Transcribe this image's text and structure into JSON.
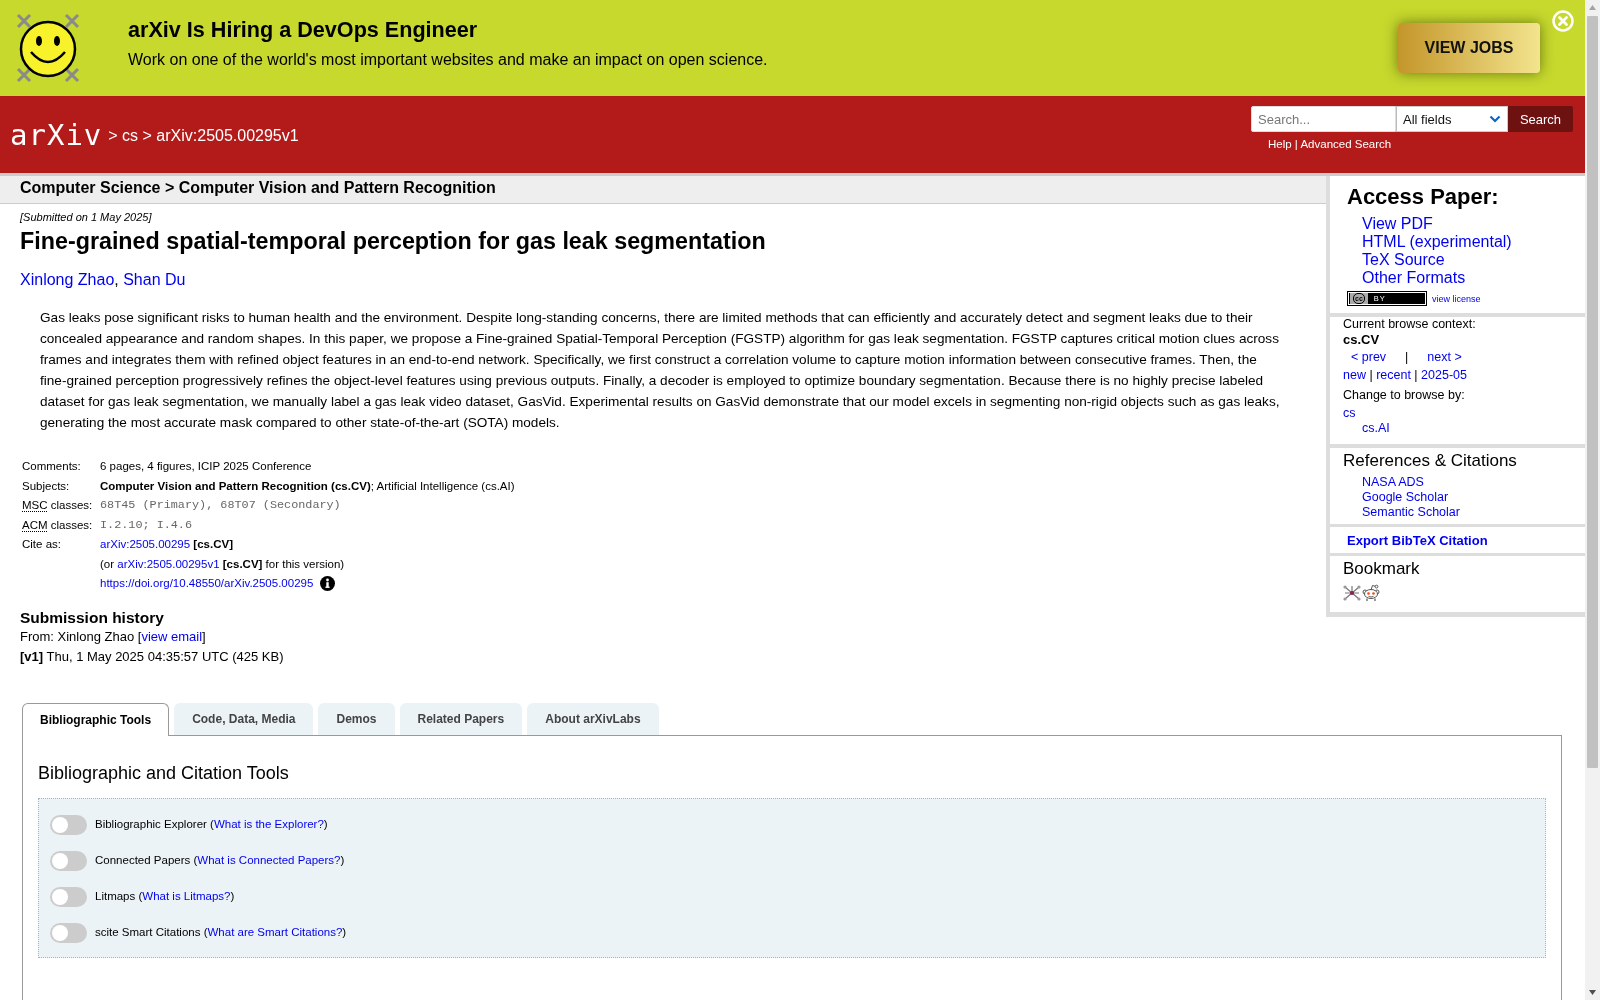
{
  "banner": {
    "title": "arXiv Is Hiring a DevOps Engineer",
    "text": "Work on one of the world's most important websites and make an impact on open science.",
    "button": "VIEW JOBS"
  },
  "header": {
    "logo": "arXiv",
    "breadcrumb": "> cs > arXiv:2505.00295v1",
    "search": {
      "placeholder": "Search...",
      "field": "All fields",
      "button": "Search"
    },
    "links": [
      "Help",
      "Advanced Search"
    ],
    "links_separator": "|"
  },
  "category_bar": "Computer Science > Computer Vision and Pattern Recognition",
  "paper": {
    "submitted": "[Submitted on 1 May 2025]",
    "title": "Fine-grained spatial-temporal perception for gas leak segmentation",
    "authors": [
      {
        "kind": "link",
        "text": "Xinlong Zhao"
      },
      {
        "kind": "text",
        "text": ", "
      },
      {
        "kind": "link",
        "text": "Shan Du"
      }
    ],
    "abstract": "Gas leaks pose significant risks to human health and the environment. Despite long-standing concerns, there are limited methods that can efficiently and accurately detect and segment leaks due to their concealed appearance and random shapes. In this paper, we propose a Fine-grained Spatial-Temporal Perception (FGSTP) algorithm for gas leak segmentation. FGSTP captures critical motion clues across frames and integrates them with refined object features in an end-to-end network. Specifically, we first construct a correlation volume to capture motion information between consecutive frames. Then, the fine-grained perception progressively refines the object-level features using previous outputs. Finally, a decoder is employed to optimize boundary segmentation. Because there is no highly precise labeled dataset for gas leak segmentation, we manually label a gas leak video dataset, GasVid. Experimental results on GasVid demonstrate that our model excels in segmenting non-rigid objects such as gas leaks, generating the most accurate mask compared to other state-of-the-art (SOTA) models.",
    "metadata": [
      {
        "label": "Comments:",
        "kind": "plain",
        "lines": [
          {
            "parts": [
              {
                "kind": "text",
                "text": "6 pages, 4 figures, ICIP 2025 Conference"
              }
            ]
          }
        ]
      },
      {
        "label": "Subjects:",
        "kind": "plain",
        "lines": [
          {
            "parts": [
              {
                "kind": "text",
                "text": "**Computer Vision and Pattern Recognition (cs.CV)**; Artificial Intelligence (cs.AI)"
              }
            ]
          }
        ]
      },
      {
        "abbr": "MSC",
        "label": "classes:",
        "kind": "mono",
        "lines": [
          {
            "parts": [
              {
                "kind": "text",
                "text": "68T45 (Primary), 68T07 (Secondary)"
              }
            ]
          }
        ]
      },
      {
        "abbr": "ACM",
        "label": "classes:",
        "kind": "mono",
        "lines": [
          {
            "parts": [
              {
                "kind": "text",
                "text": "I.2.10; I.4.6"
              }
            ]
          }
        ]
      },
      {
        "label": "Cite as:",
        "kind": "plain",
        "lines": [
          {
            "parts": [
              {
                "kind": "link",
                "text": "arXiv:2505.00295"
              },
              {
                "kind": "text",
                "text": " **[cs.CV]**"
              }
            ]
          },
          {
            "parts": [
              {
                "kind": "text",
                "text": "(or "
              },
              {
                "kind": "link",
                "text": "arXiv:2505.00295v1"
              },
              {
                "kind": "text",
                "text": " **[cs.CV]** for this version)"
              }
            ]
          },
          {
            "parts": [
              {
                "kind": "link",
                "text": "https://doi.org/10.48550/arXiv.2505.00295"
              },
              {
                "kind": "info"
              }
            ]
          }
        ]
      }
    ],
    "history": {
      "heading": "Submission history",
      "from": [
        {
          "kind": "text",
          "text": "From: Xinlong Zhao ["
        },
        {
          "kind": "link",
          "text": "view email"
        },
        {
          "kind": "text",
          "text": "]"
        }
      ],
      "versions": [
        "**[v1]** Thu, 1 May 2025 04:35:57 UTC (425 KB)"
      ]
    }
  },
  "sidebar": {
    "access": {
      "heading": "Access Paper:",
      "links": [
        "View PDF",
        "HTML (experimental)",
        "TeX Source",
        "Other Formats"
      ],
      "license": {
        "badge": [
          "cc",
          "BY"
        ],
        "link": "view license"
      }
    },
    "context": {
      "label": "Current browse context:",
      "current": "cs.CV",
      "nav": [
        {
          "kind": "link",
          "text": "< prev"
        },
        {
          "kind": "separator",
          "text": "|"
        },
        {
          "kind": "link",
          "text": "next >"
        }
      ],
      "lists": [
        {
          "kind": "link",
          "text": "new"
        },
        {
          "kind": "text",
          "text": " | "
        },
        {
          "kind": "link",
          "text": "recent"
        },
        {
          "kind": "text",
          "text": " | "
        },
        {
          "kind": "link",
          "text": "2025-05"
        }
      ],
      "change_label": "Change to browse by:",
      "browse": [
        {
          "text": "cs",
          "children": [
            {
              "text": "cs.AI"
            }
          ]
        }
      ]
    },
    "references": {
      "heading": "References & Citations",
      "links": [
        "NASA ADS",
        "Google Scholar",
        "Semantic Scholar"
      ]
    },
    "export": "Export BibTeX Citation",
    "bookmark": {
      "heading": "Bookmark"
    }
  },
  "labs": {
    "tabs": [
      {
        "label": "Bibliographic Tools",
        "selected": true
      },
      {
        "label": "Code, Data, Media",
        "selected": false
      },
      {
        "label": "Demos",
        "selected": false
      },
      {
        "label": "Related Papers",
        "selected": false
      },
      {
        "label": "About arXivLabs",
        "selected": false
      }
    ],
    "heading": "Bibliographic and Citation Tools",
    "tools": [
      {
        "on": false,
        "parts": [
          {
            "kind": "text",
            "text": "Bibliographic Explorer ("
          },
          {
            "kind": "link",
            "text": "What is the Explorer?"
          },
          {
            "kind": "text",
            "text": ")"
          }
        ]
      },
      {
        "on": false,
        "parts": [
          {
            "kind": "text",
            "text": "Connected Papers ("
          },
          {
            "kind": "link",
            "text": "What is Connected Papers?"
          },
          {
            "kind": "text",
            "text": ")"
          }
        ]
      },
      {
        "on": false,
        "parts": [
          {
            "kind": "text",
            "text": "Litmaps ("
          },
          {
            "kind": "link",
            "text": "What is Litmaps?"
          },
          {
            "kind": "text",
            "text": ")"
          }
        ]
      },
      {
        "on": false,
        "parts": [
          {
            "kind": "text",
            "text": "scite Smart Citations ("
          },
          {
            "kind": "link",
            "text": "What are Smart Citations?"
          },
          {
            "kind": "text",
            "text": ")"
          }
        ]
      }
    ]
  }
}
